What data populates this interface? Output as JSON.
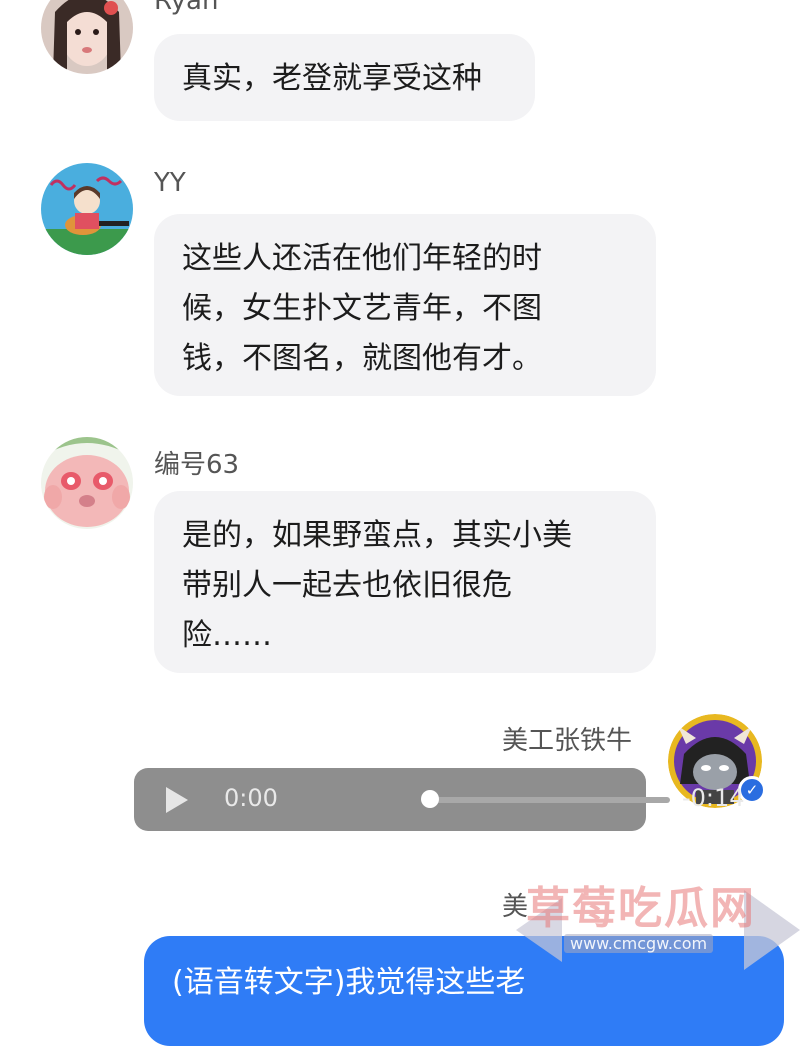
{
  "messages": [
    {
      "sender": "Ryan",
      "lines": [
        "真实，老登就享受这种"
      ]
    },
    {
      "sender": "YY",
      "lines": [
        "这些人还活在他们年轻的时",
        "候，女生扑文艺青年，不图",
        "钱，不图名，就图他有才。"
      ]
    },
    {
      "sender": "编号63",
      "lines": [
        "是的，如果野蛮点，其实小美",
        "带别人一起去也依旧很危",
        "险……"
      ]
    }
  ],
  "voice_message": {
    "sender": "美工张铁牛",
    "current_time": "0:00",
    "remaining_time": "-0:14",
    "progress": 0.0
  },
  "next_message": {
    "sender_partial": "美",
    "text": "(语音转文字)我觉得这些老"
  },
  "watermark": {
    "title": "草莓吃瓜网",
    "url": "www.cmcgw.com"
  },
  "colors": {
    "bubble_gray": "#f3f3f5",
    "bubble_blue": "#2f7cf6",
    "audio_bg": "#8e8e8e"
  }
}
